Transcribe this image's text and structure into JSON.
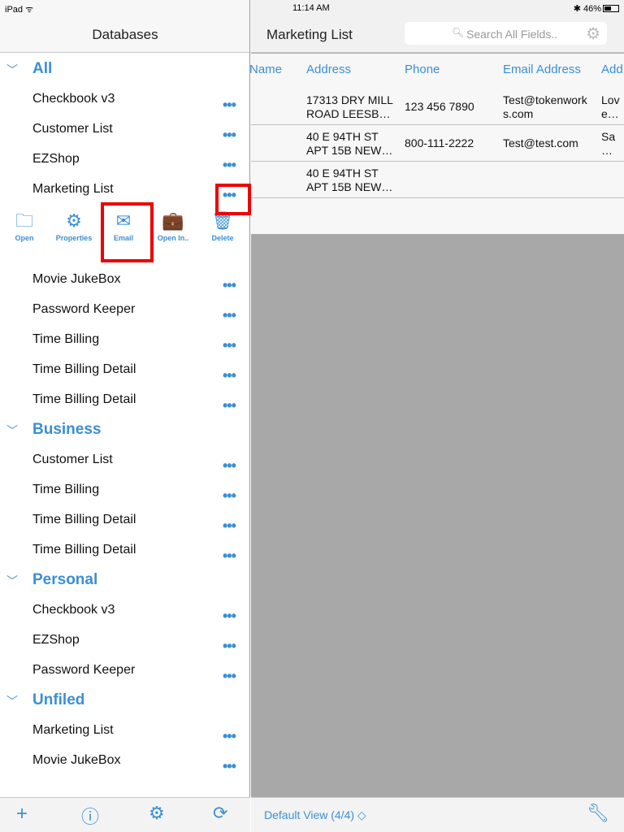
{
  "status": {
    "device": "iPad",
    "time": "11:14 AM",
    "battery": "46%"
  },
  "left": {
    "title": "Databases",
    "sections": [
      {
        "name": "All",
        "items": [
          "Checkbook v3",
          "Customer List",
          "EZShop",
          "Marketing List",
          "Movie JukeBox",
          "Password Keeper",
          "Time Billing",
          "Time Billing Detail",
          "Time Billing Detail"
        ]
      },
      {
        "name": "Business",
        "items": [
          "Customer List",
          "Time Billing",
          "Time Billing Detail",
          "Time Billing Detail"
        ]
      },
      {
        "name": "Personal",
        "items": [
          "Checkbook v3",
          "EZShop",
          "Password Keeper"
        ]
      },
      {
        "name": "Unfiled",
        "items": [
          "Marketing List",
          "Movie JukeBox"
        ]
      }
    ],
    "actions": [
      "Open",
      "Properties",
      "Email",
      "Open In..",
      "Delete"
    ],
    "footer_icons": [
      "plus-icon",
      "info-icon",
      "gear-icon",
      "sync-icon"
    ]
  },
  "right": {
    "title": "Marketing List",
    "search_placeholder": "Search All Fields..",
    "columns": [
      "Name",
      "Address",
      "Phone",
      "Email Address",
      "Add"
    ],
    "rows": [
      [
        "",
        "17313 DRY MILL\nROAD LEESB…",
        "123 456 7890",
        "Test@tokenwork\ns.com",
        "Lov\ne…"
      ],
      [
        "",
        "40 E 94TH ST\nAPT 15B NEW…",
        "800-111-2222",
        "Test@test.com",
        "Sa\n…"
      ],
      [
        "",
        "40 E 94TH ST\nAPT 15B NEW…",
        "",
        "",
        ""
      ]
    ],
    "footer": {
      "view": "Default View  (4/4)"
    }
  }
}
